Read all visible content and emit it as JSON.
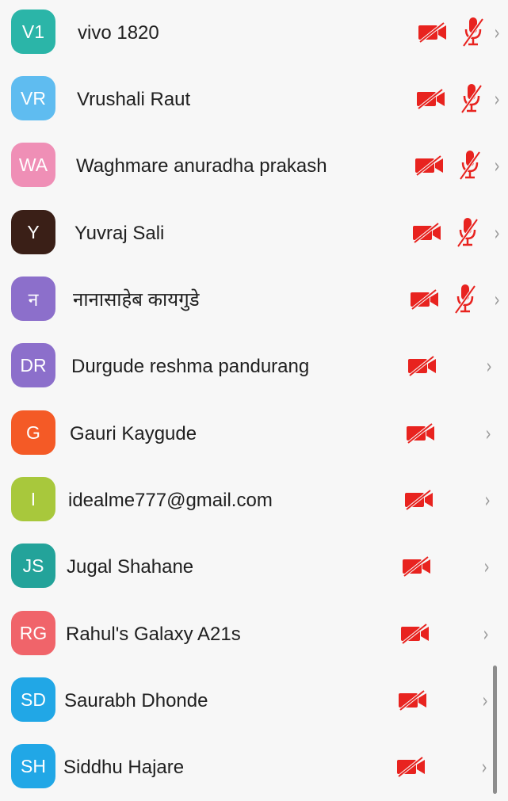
{
  "participants": [
    {
      "initials": "V1",
      "name": "vivo 1820",
      "color": "#2bb5a8",
      "video_muted": true,
      "mic_muted": true
    },
    {
      "initials": "VR",
      "name": "Vrushali Raut",
      "color": "#5fbcf0",
      "video_muted": true,
      "mic_muted": true
    },
    {
      "initials": "WA",
      "name": "Waghmare anuradha prakash",
      "color": "#ef8fb6",
      "video_muted": true,
      "mic_muted": true
    },
    {
      "initials": "Y",
      "name": "Yuvraj Sali",
      "color": "#3a1f17",
      "video_muted": true,
      "mic_muted": true
    },
    {
      "initials": "न",
      "name": "नानासाहेब कायगुडे",
      "color": "#8c6fcb",
      "video_muted": true,
      "mic_muted": true
    },
    {
      "initials": "DR",
      "name": "Durgude reshma pandurang",
      "color": "#8c6fcb",
      "video_muted": true,
      "mic_muted": false
    },
    {
      "initials": "G",
      "name": "Gauri Kaygude",
      "color": "#f45a26",
      "video_muted": true,
      "mic_muted": false
    },
    {
      "initials": "I",
      "name": "idealme777@gmail.com",
      "color": "#a8c83c",
      "video_muted": true,
      "mic_muted": false
    },
    {
      "initials": "JS",
      "name": "Jugal Shahane",
      "color": "#23a39a",
      "video_muted": true,
      "mic_muted": false
    },
    {
      "initials": "RG",
      "name": "Rahul's Galaxy A21s",
      "color": "#f0646a",
      "video_muted": true,
      "mic_muted": false
    },
    {
      "initials": "SD",
      "name": "Saurabh Dhonde",
      "color": "#21a7e6",
      "video_muted": true,
      "mic_muted": false
    },
    {
      "initials": "SH",
      "name": "Siddhu Hajare",
      "color": "#21a7e6",
      "video_muted": true,
      "mic_muted": false
    }
  ],
  "icons": {
    "video_muted": "video-off-icon",
    "mic_muted": "mic-off-icon",
    "chevron": "chevron-right-icon"
  },
  "colors": {
    "muted_icon": "#e8231f",
    "chevron": "#9a9a9a",
    "name_text": "#202020",
    "background": "#f7f7f7"
  }
}
